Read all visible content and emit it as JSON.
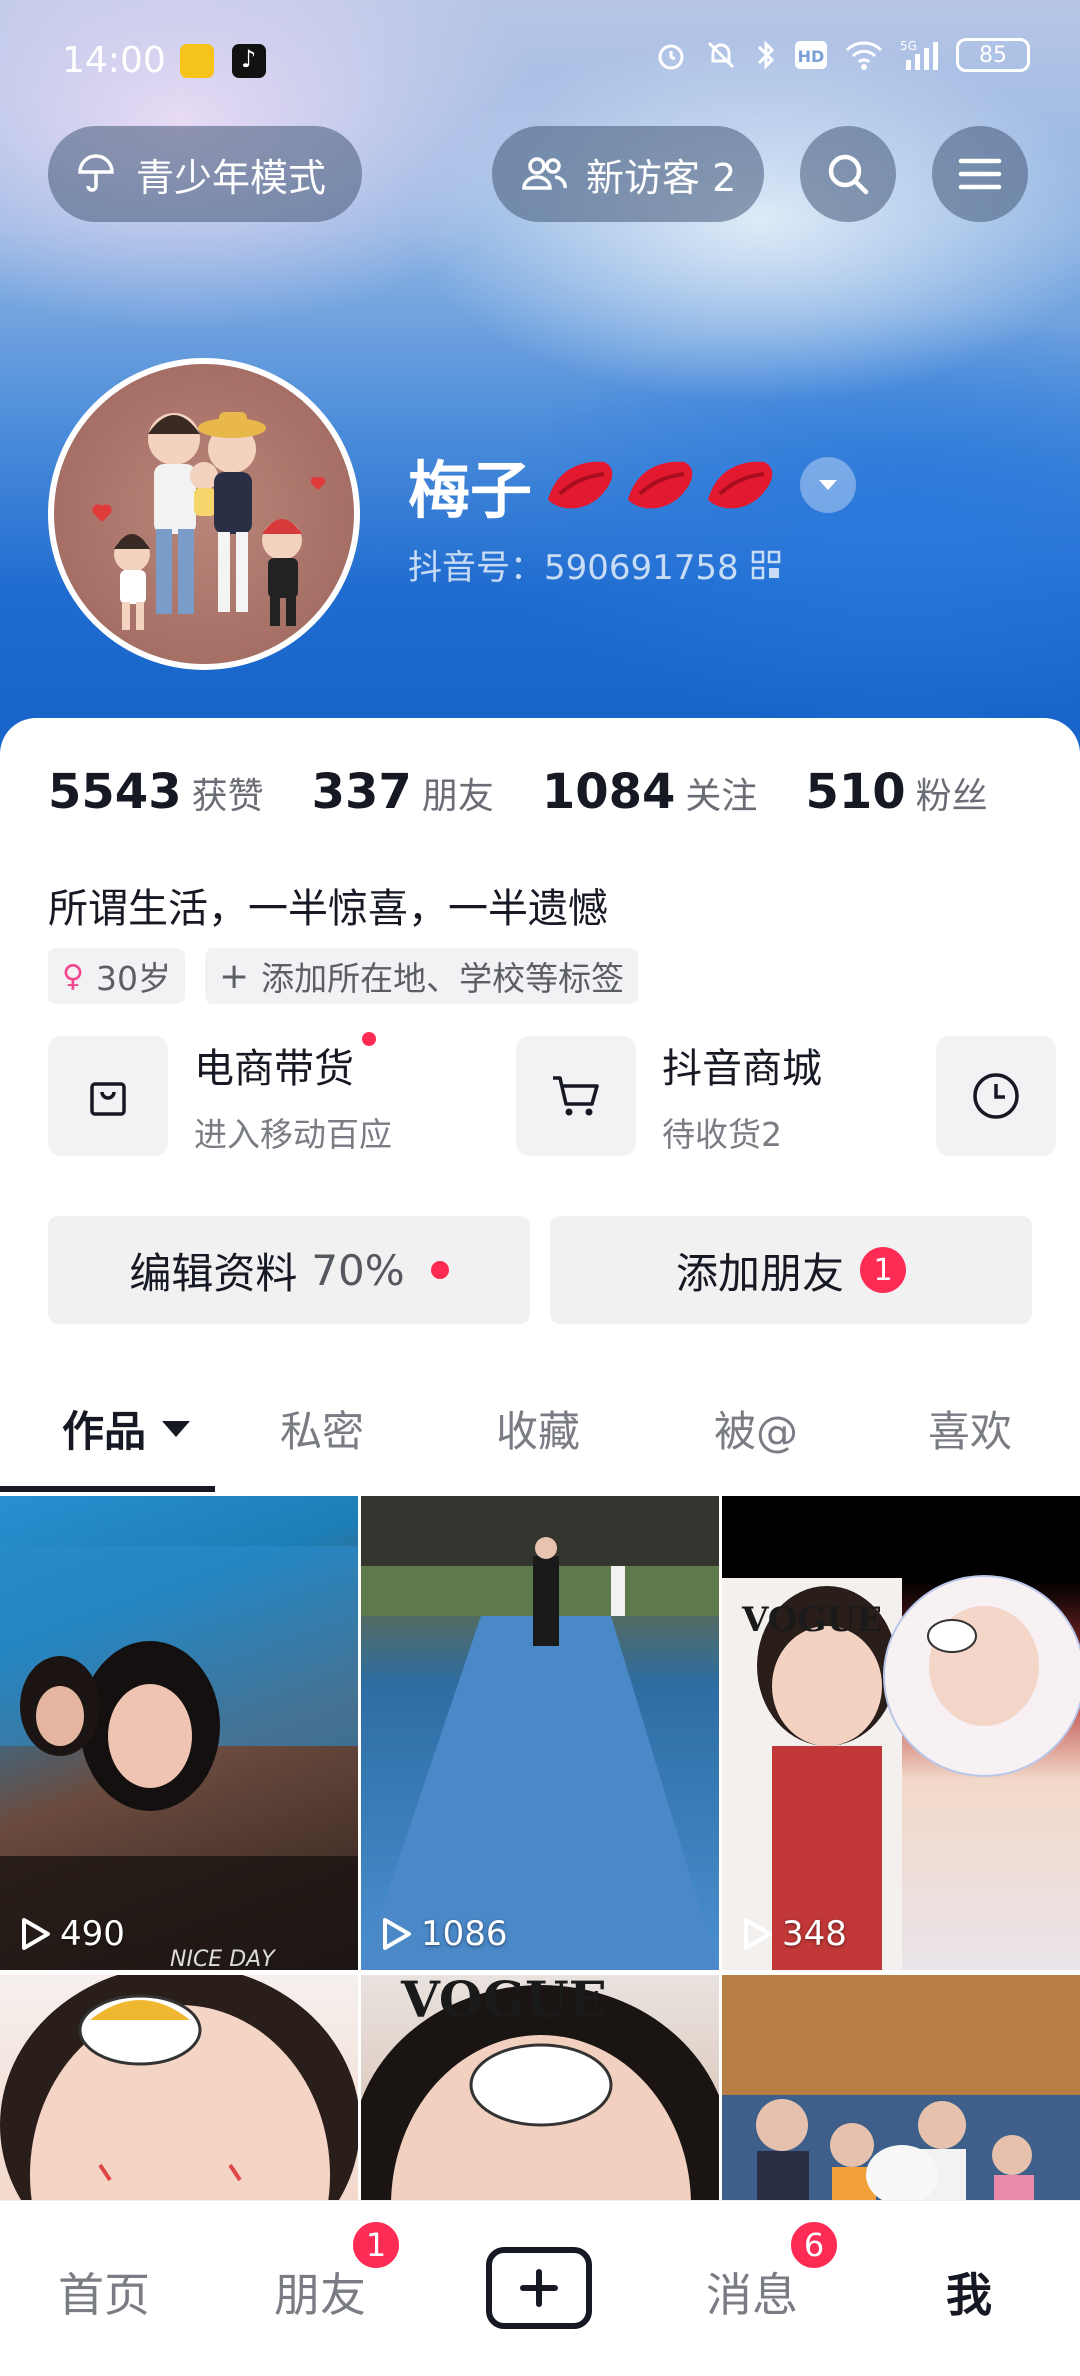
{
  "status_bar": {
    "time": "14:00",
    "battery": "85",
    "icons": [
      "alarm-icon",
      "mute-icon",
      "bluetooth-icon",
      "hd-icon",
      "wifi-icon",
      "signal-5g-icon"
    ]
  },
  "top_bar": {
    "youth_mode_label": "青少年模式",
    "new_visitors_label": "新访客 2"
  },
  "profile": {
    "name": "梅子",
    "douyin_id": "抖音号：590691758"
  },
  "stats": [
    {
      "value": "5543",
      "label": "获赞"
    },
    {
      "value": "337",
      "label": "朋友"
    },
    {
      "value": "1084",
      "label": "关注"
    },
    {
      "value": "510",
      "label": "粉丝"
    }
  ],
  "bio": "所谓生活，一半惊喜，一半遗憾",
  "tags": {
    "age": "30岁",
    "add_tag": "添加所在地、学校等标签"
  },
  "services": {
    "commerce_title": "电商带货",
    "commerce_sub": "进入移动百应",
    "mall_title": "抖音商城",
    "mall_sub": "待收货2"
  },
  "actions": {
    "edit_label": "编辑资料",
    "edit_pct": "70%",
    "add_friend_label": "添加朋友",
    "add_friend_badge": "1"
  },
  "tabs": [
    "作品",
    "私密",
    "收藏",
    "被@",
    "喜欢"
  ],
  "videos": [
    {
      "plays": "490",
      "overlay": "NICE DAY"
    },
    {
      "plays": "1086"
    },
    {
      "plays": "348",
      "overlay": "VOGUE"
    },
    {},
    {
      "overlay": "VOGUE"
    },
    {}
  ],
  "bottom_nav": {
    "home": "首页",
    "friends": "朋友",
    "friends_badge": "1",
    "messages": "消息",
    "messages_badge": "6",
    "me": "我"
  },
  "colors": {
    "accent": "#fe2c55",
    "text": "#161823",
    "secondary_text": "#7a7c84"
  }
}
